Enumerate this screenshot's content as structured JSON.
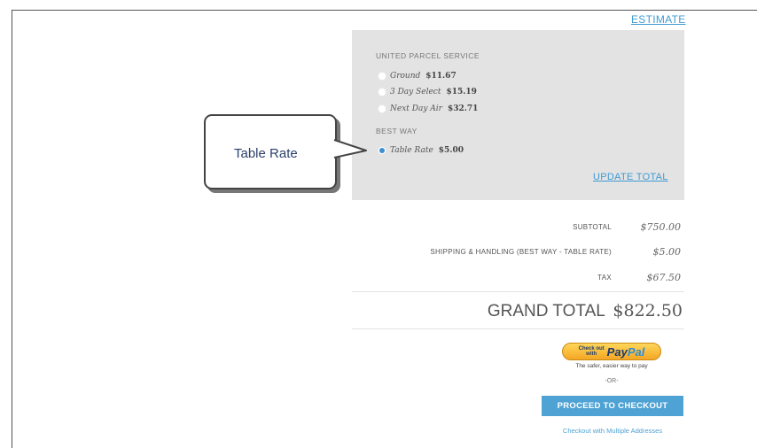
{
  "estimate_link": "ESTIMATE",
  "shipping": {
    "carriers": [
      {
        "heading": "UNITED PARCEL SERVICE",
        "options": [
          {
            "method": "Ground",
            "price": "$11.67",
            "selected": false
          },
          {
            "method": "3 Day Select",
            "price": "$15.19",
            "selected": false
          },
          {
            "method": "Next Day Air",
            "price": "$32.71",
            "selected": false
          }
        ]
      },
      {
        "heading": "BEST WAY",
        "options": [
          {
            "method": "Table Rate",
            "price": "$5.00",
            "selected": true
          }
        ]
      }
    ],
    "update_total_link": "UPDATE TOTAL"
  },
  "callout": {
    "text": "Table Rate"
  },
  "totals": {
    "rows": [
      {
        "label": "SUBTOTAL",
        "value": "$750.00"
      },
      {
        "label": "SHIPPING & HANDLING (BEST WAY - TABLE RATE)",
        "value": "$5.00"
      },
      {
        "label": "TAX",
        "value": "$67.50"
      }
    ],
    "grand_total_label": "GRAND TOTAL",
    "grand_total_value": "$822.50"
  },
  "paypal": {
    "prefix_line1": "Check out",
    "prefix_line2": "with",
    "logo_pay": "Pay",
    "logo_pal": "Pal",
    "tagline": "The safer, easier way to pay"
  },
  "or_text": "-OR-",
  "checkout_button": "PROCEED TO CHECKOUT",
  "multi_address_link": "Checkout with Multiple Addresses",
  "colors": {
    "accent": "#4fa3d4",
    "panel": "#e3e3e3",
    "radio_selected": "#3b8fd1"
  }
}
